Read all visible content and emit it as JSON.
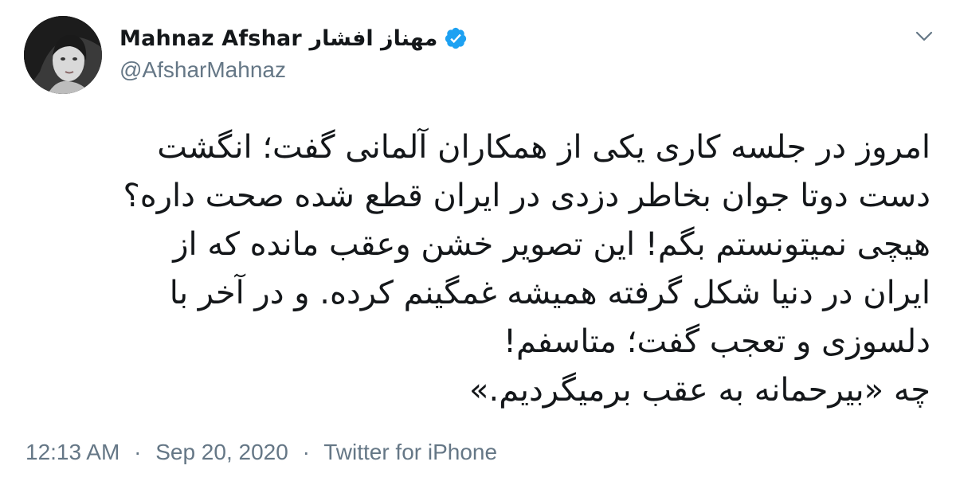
{
  "tweet": {
    "author": {
      "display_name": "Mahnaz Afshar مهناز افشار",
      "handle": "@AfsharMahnaz",
      "verified": true,
      "avatar": "profile-photo"
    },
    "menu_icon": "chevron-down-icon",
    "text": "امروز در جلسه کاری یکی از همکاران آلمانی گفت؛ انگشت\nدست دوتا جوان بخاطر دزدی در ایران قطع شده صحت داره؟\nهیچی نمیتونستم بگم! این تصویر خشن وعقب مانده که از\nایران در دنیا شکل گرفته همیشه غمگینم کرده. و در آخر با\nدلسوزی و تعجب گفت؛ متاسفم!\nچه «بیرحمانه به عقب برمیگردیم.»",
    "time": "12:13 AM",
    "date": "Sep 20, 2020",
    "separator": "·",
    "source": "Twitter for iPhone"
  },
  "colors": {
    "text": "#14171a",
    "secondary": "#657786",
    "verified": "#1da1f2",
    "background": "#ffffff"
  }
}
